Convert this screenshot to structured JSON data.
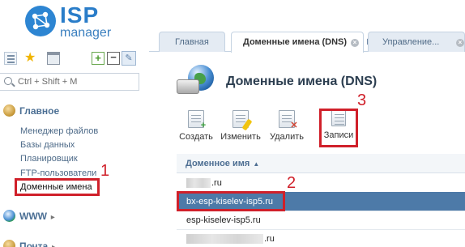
{
  "brand": {
    "name_isp": "ISP",
    "name_manager": "manager"
  },
  "sidebar": {
    "search_placeholder": "Ctrl + Shift + M",
    "groups": [
      {
        "title": "Главное",
        "items": [
          "Менеджер файлов",
          "Базы данных",
          "Планировщик",
          "FTP-пользователи",
          "Доменные имена"
        ]
      },
      {
        "title": "WWW"
      },
      {
        "title": "Почта"
      }
    ],
    "selected_item": "Доменные имена"
  },
  "tabs": [
    {
      "label": "Главная"
    },
    {
      "label": "Доменные имена (DNS)",
      "active": true
    },
    {
      "label": "Управление..."
    }
  ],
  "page": {
    "title": "Доменные имена (DNS)",
    "actions": [
      "Создать",
      "Изменить",
      "Удалить",
      "Записи"
    ]
  },
  "table": {
    "column": "Доменное имя",
    "rows": [
      {
        "suffix": ".ru",
        "redacted": true
      },
      {
        "name": "bx-esp-kiselev-isp5.ru",
        "selected": true
      },
      {
        "name": "esp-kiselev-isp5.ru"
      },
      {
        "suffix": ".ru",
        "redacted": true
      }
    ]
  },
  "annotations": {
    "step1": "1",
    "step2": "2",
    "step3": "3",
    "color": "#d0202a"
  },
  "colors": {
    "accent": "#2a7dc9",
    "selected_row": "#4d7aa8",
    "nav_link": "#4d6a88"
  }
}
